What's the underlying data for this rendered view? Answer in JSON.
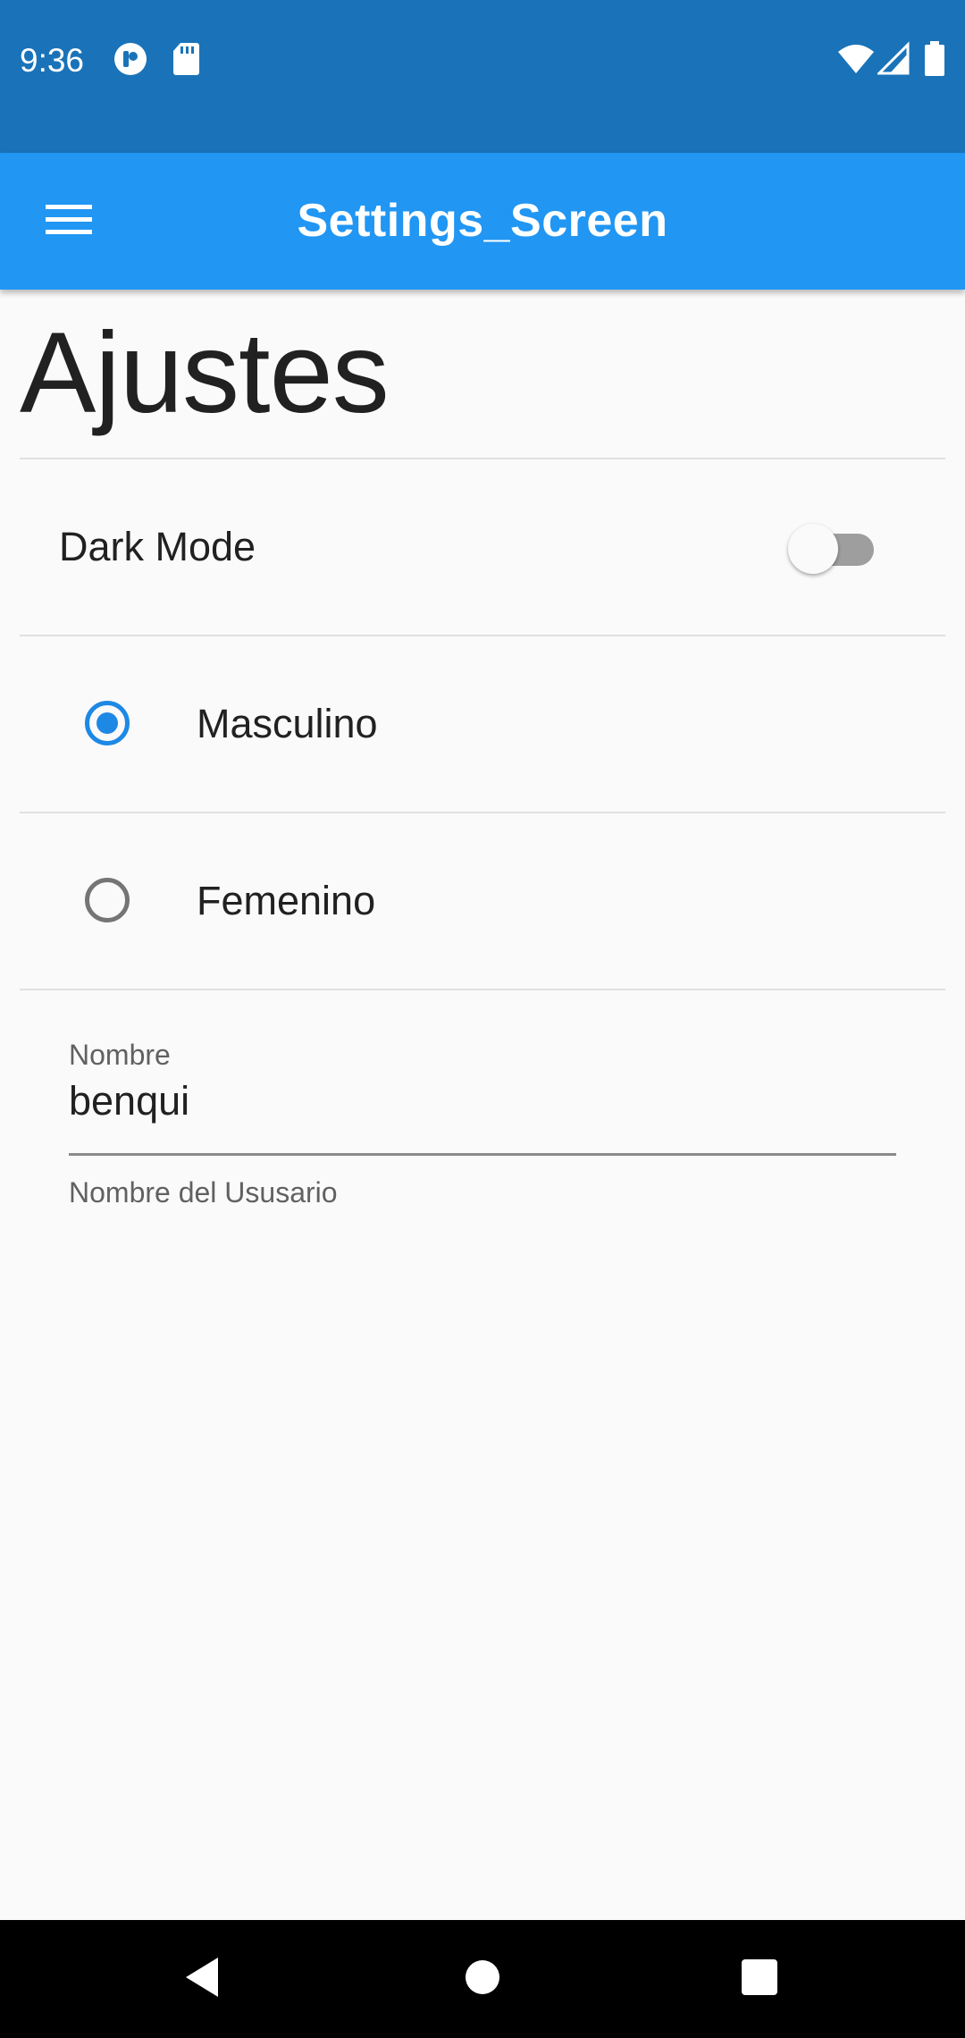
{
  "status_bar": {
    "time": "9:36",
    "left_icons": [
      "notification-app-icon",
      "sd-card-icon"
    ],
    "right_icons": [
      "wifi-icon",
      "signal-icon",
      "battery-icon"
    ],
    "background_color": "#1a73b8"
  },
  "app_bar": {
    "title": "Settings_Screen",
    "menu_icon": "hamburger-menu-icon",
    "background_color": "#2196f3"
  },
  "page": {
    "heading": "Ajustes"
  },
  "dark_mode": {
    "label": "Dark Mode",
    "enabled": false
  },
  "gender": {
    "options": [
      {
        "label": "Masculino",
        "selected": true
      },
      {
        "label": "Femenino",
        "selected": false
      }
    ],
    "accent_color": "#1e88e5"
  },
  "name_field": {
    "label": "Nombre",
    "value": "benqui",
    "helper": "Nombre del Ususario"
  },
  "nav_bar": {
    "buttons": [
      "back-icon",
      "home-icon",
      "recents-icon"
    ]
  }
}
